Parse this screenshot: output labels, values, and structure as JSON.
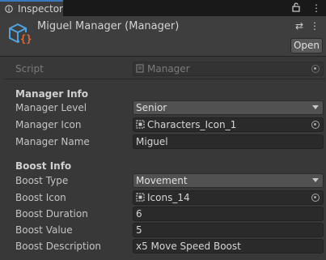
{
  "tab": {
    "label": "Inspector"
  },
  "header": {
    "title": "Miguel Manager (Manager)",
    "open_label": "Open"
  },
  "script": {
    "label": "Script",
    "value": "Manager"
  },
  "manager_info": {
    "heading": "Manager Info",
    "level_label": "Manager Level",
    "level_value": "Senior",
    "icon_label": "Manager Icon",
    "icon_value": "Characters_Icon_1",
    "name_label": "Manager Name",
    "name_value": "Miguel"
  },
  "boost_info": {
    "heading": "Boost Info",
    "type_label": "Boost Type",
    "type_value": "Movement",
    "icon_label": "Boost Icon",
    "icon_value": "Icons_14",
    "duration_label": "Boost Duration",
    "duration_value": "6",
    "value_label": "Boost Value",
    "value_value": "5",
    "description_label": "Boost Description",
    "description_value": "x5 Move Speed Boost"
  },
  "colors": {
    "accent": "#3a79bb",
    "background": "#383838",
    "field": "#2a2a2a"
  }
}
